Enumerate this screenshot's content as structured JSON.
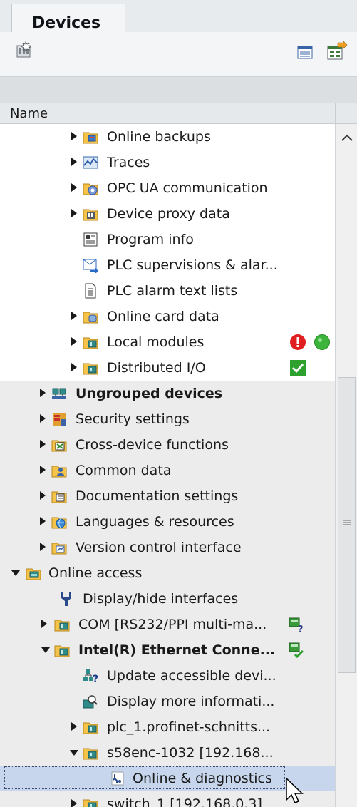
{
  "tab": {
    "label": "Devices"
  },
  "columns": {
    "name": "Name"
  },
  "rows": [
    {
      "label": "Online backups",
      "icon": "online-backups-icon",
      "bold": false
    },
    {
      "label": "Traces",
      "icon": "traces-icon",
      "bold": false
    },
    {
      "label": "OPC UA communication",
      "icon": "opc-ua-icon",
      "bold": false
    },
    {
      "label": "Device proxy data",
      "icon": "device-proxy-icon",
      "bold": false
    },
    {
      "label": "Program info",
      "icon": "program-info-icon",
      "bold": false
    },
    {
      "label": "PLC supervisions & alar...",
      "icon": "plc-supervision-icon",
      "bold": false
    },
    {
      "label": "PLC alarm text lists",
      "icon": "alarm-text-icon",
      "bold": false
    },
    {
      "label": "Online card data",
      "icon": "online-card-icon",
      "bold": false
    },
    {
      "label": "Local modules",
      "icon": "modules-folder-icon",
      "bold": false,
      "status": [
        "error-icon",
        "online-ok-icon"
      ]
    },
    {
      "label": "Distributed I/O",
      "icon": "modules-folder-icon",
      "bold": false,
      "status": [
        "check-icon"
      ]
    },
    {
      "label": "Ungrouped devices",
      "icon": "ungrouped-devices-icon",
      "bold": true
    },
    {
      "label": "Security settings",
      "icon": "security-settings-icon",
      "bold": false
    },
    {
      "label": "Cross-device functions",
      "icon": "cross-device-icon",
      "bold": false
    },
    {
      "label": "Common data",
      "icon": "common-data-icon",
      "bold": false
    },
    {
      "label": "Documentation settings",
      "icon": "documentation-icon",
      "bold": false
    },
    {
      "label": "Languages & resources",
      "icon": "languages-icon",
      "bold": false
    },
    {
      "label": "Version control interface",
      "icon": "version-control-icon",
      "bold": false
    },
    {
      "label": "Online access",
      "icon": "online-access-icon",
      "bold": false
    },
    {
      "label": "Display/hide interfaces",
      "icon": "interfaces-icon",
      "bold": false
    },
    {
      "label": "COM [RS232/PPI multi-ma...",
      "icon": "interface-folder-icon",
      "bold": false,
      "status": [
        "adapter-unknown-icon"
      ]
    },
    {
      "label": "Intel(R) Ethernet Conne...",
      "icon": "interface-folder-icon",
      "bold": true,
      "status": [
        "adapter-ok-icon"
      ]
    },
    {
      "label": "Update accessible devi...",
      "icon": "update-devices-icon",
      "bold": false
    },
    {
      "label": "Display more informati...",
      "icon": "more-info-icon",
      "bold": false
    },
    {
      "label": "plc_1.profinet-schnitts...",
      "icon": "device-folder-icon",
      "bold": false
    },
    {
      "label": "s58enc-1032 [192.168...",
      "icon": "device-folder-icon",
      "bold": false
    },
    {
      "label": "Online & diagnostics",
      "icon": "diagnostics-icon",
      "bold": false
    },
    {
      "label": "switch_1 [192.168.0.3]",
      "icon": "device-folder-icon",
      "bold": false
    }
  ],
  "colors": {
    "selection": "#c7d6ec",
    "error": "#e02020",
    "online": "#3cb43c",
    "check": "#2ea02e"
  }
}
